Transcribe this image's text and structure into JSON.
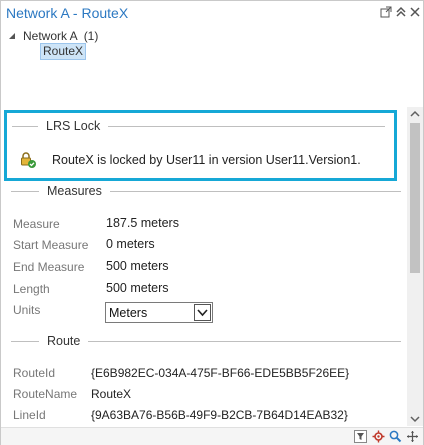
{
  "window": {
    "title": "Network A - RouteX"
  },
  "tree": {
    "parent_label": "Network A",
    "parent_count": "(1)",
    "child_label": "RouteX"
  },
  "lrs_lock": {
    "title": "LRS Lock",
    "message": "RouteX is locked by User11 in version User11.Version1."
  },
  "measures": {
    "title": "Measures",
    "rows": [
      {
        "label": "Measure",
        "value": "187.5 meters"
      },
      {
        "label": "Start Measure",
        "value": "0 meters"
      },
      {
        "label": "End Measure",
        "value": "500 meters"
      },
      {
        "label": "Length",
        "value": "500 meters"
      }
    ],
    "units_label": "Units",
    "units_value": "Meters"
  },
  "route": {
    "title": "Route",
    "rows": [
      {
        "label": "RouteId",
        "value": "{E6B982EC-034A-475F-BF66-EDE5BB5F26EE}"
      },
      {
        "label": "RouteName",
        "value": "RouteX"
      },
      {
        "label": "LineId",
        "value": "{9A63BA76-B56B-49F9-B2CB-7B64D14EAB32}"
      }
    ]
  },
  "icons": {
    "lock": "lock-check-icon",
    "float": "float-window-icon",
    "collapse": "chevron-up-icon",
    "close": "close-icon",
    "filter": "filter-icon",
    "settings": "gear-icon",
    "zoom": "zoom-icon",
    "pan": "pan-icon"
  },
  "colors": {
    "title": "#2b78c2",
    "lock_highlight": "#16a8d6",
    "selection": "#cde4f7"
  }
}
